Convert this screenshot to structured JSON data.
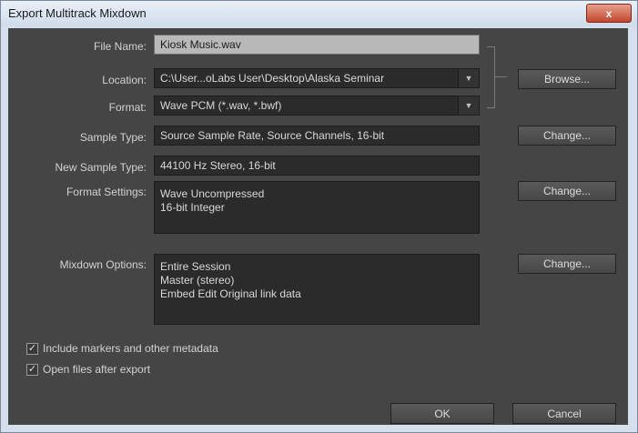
{
  "window": {
    "title": "Export Multitrack Mixdown",
    "close_label": "x"
  },
  "form": {
    "file_name": {
      "label": "File Name:",
      "value": "Kiosk Music.wav"
    },
    "location": {
      "label": "Location:",
      "value": "C:\\User...oLabs User\\Desktop\\Alaska Seminar"
    },
    "format": {
      "label": "Format:",
      "value": "Wave PCM (*.wav, *.bwf)"
    },
    "sample_type": {
      "label": "Sample Type:",
      "value": "Source Sample Rate, Source Channels, 16-bit"
    },
    "new_sample_type": {
      "label": "New Sample Type:",
      "value": "44100 Hz Stereo, 16-bit"
    },
    "format_settings": {
      "label": "Format Settings:",
      "lines": [
        "Wave Uncompressed",
        "16-bit Integer"
      ]
    },
    "mixdown_options": {
      "label": "Mixdown Options:",
      "lines": [
        "Entire Session",
        "Master (stereo)",
        "Embed Edit Original link data"
      ]
    }
  },
  "buttons": {
    "browse": "Browse...",
    "change_sample": "Change...",
    "change_format": "Change...",
    "change_mixdown": "Change...",
    "ok": "OK",
    "cancel": "Cancel"
  },
  "checkboxes": [
    {
      "label": "Include markers and other metadata",
      "checked": true
    },
    {
      "label": "Open files after export",
      "checked": true
    }
  ],
  "icons": {
    "dropdown": "chevron-down-icon",
    "check": "checkmark-icon"
  }
}
